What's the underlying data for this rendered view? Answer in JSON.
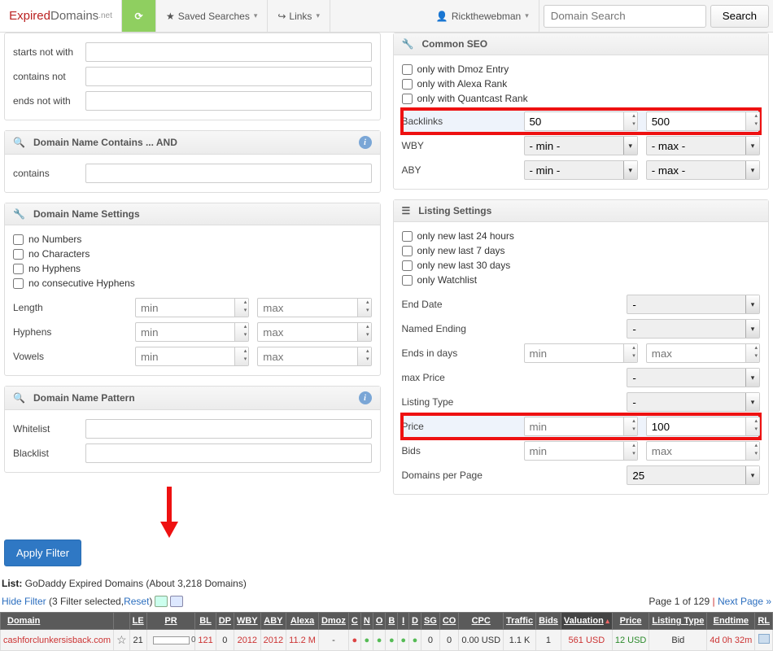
{
  "nav": {
    "brand_expired": "Expired",
    "brand_domains": "Domains",
    "brand_net": ".net",
    "check": "✓",
    "saved": "Saved Searches",
    "links": "Links",
    "user": "Rickthewebman",
    "search_ph": "Domain Search",
    "search_btn": "Search"
  },
  "left": {
    "f1": {
      "r1": "starts not with",
      "r2": "contains not",
      "r3": "ends not with"
    },
    "hd_contains": "Domain Name Contains ... AND",
    "contains_lbl": "contains",
    "hd_settings": "Domain Name Settings",
    "chk": [
      "no Numbers",
      "no Characters",
      "no Hyphens",
      "no consecutive Hyphens"
    ],
    "length": "Length",
    "hyphens": "Hyphens",
    "vowels": "Vowels",
    "min": "min",
    "max": "max",
    "hd_pattern": "Domain Name Pattern",
    "whitelist": "Whitelist",
    "blacklist": "Blacklist"
  },
  "right": {
    "hd_seo": "Common SEO",
    "chk": [
      "only with Dmoz Entry",
      "only with Alexa Rank",
      "only with Quantcast Rank"
    ],
    "backlinks": "Backlinks",
    "bl_min": "50",
    "bl_max": "500",
    "wby": "WBY",
    "aby": "ABY",
    "selmin": "- min -",
    "selmax": "- max -",
    "hd_listing": "Listing Settings",
    "lchk": [
      "only new last 24 hours",
      "only new last 7 days",
      "only new last 30 days",
      "only Watchlist"
    ],
    "enddate": "End Date",
    "named": "Named Ending",
    "endsin": "Ends in days",
    "maxprice": "max Price",
    "ltype": "Listing Type",
    "price": "Price",
    "price_max": "100",
    "bids": "Bids",
    "dpp": "Domains per Page",
    "dpp_v": "25",
    "min": "min",
    "max": "max",
    "dash": "-"
  },
  "apply": "Apply Filter",
  "list": {
    "pre": "List: ",
    "name": "GoDaddy Expired Domains",
    "count": " (About 3,218 Domains)",
    "hide": "Hide Filter",
    "filt": "(3 Filter selected, ",
    "reset": "Reset",
    ")": ")",
    "page": "Page 1 of 129",
    "sep": " | ",
    "next": "Next Page »"
  },
  "cols": [
    "Domain",
    "",
    "LE",
    "PR",
    "BL",
    "DP",
    "WBY",
    "ABY",
    "Alexa",
    "Dmoz",
    "C",
    "N",
    "O",
    "B",
    "I",
    "D",
    "SG",
    "CO",
    "CPC",
    "Traffic",
    "Bids",
    "Valuation",
    "Price",
    "Listing Type",
    "Endtime",
    "RL"
  ],
  "rowd": {
    "domain": "cashforclunkersisback.com",
    "le": "21",
    "bl": "121",
    "dp": "0",
    "wby": "2012",
    "aby": "2012",
    "alexa": "11.2 M",
    "dmoz": "-",
    "sg": "0",
    "co": "0",
    "cpc": "0.00 USD",
    "traffic": "1.1 K",
    "bids": "1",
    "val": "561 USD",
    "price": "12 USD",
    "ltype": "Bid",
    "end": "4d 0h 32m"
  }
}
